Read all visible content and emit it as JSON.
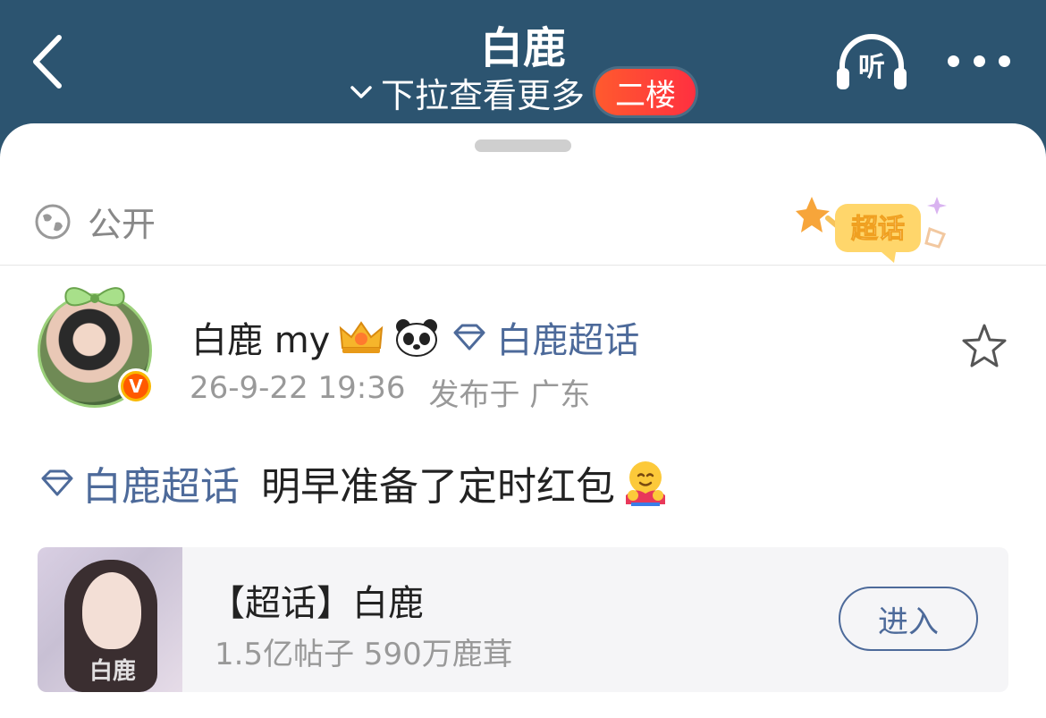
{
  "header": {
    "title": "白鹿",
    "subtitle": "下拉查看更多",
    "floor_badge": "二楼",
    "listen_label": "听"
  },
  "post": {
    "visibility": "公开",
    "chaohua_badge": "超话",
    "author": {
      "name": "白鹿 my",
      "topic": "白鹿超话",
      "verified_mark": "V"
    },
    "timestamp": "26-9-22 19:36",
    "location": "发布于 广东",
    "content_topic": "白鹿超话",
    "content_text": "明早准备了定时红包"
  },
  "topic_card": {
    "title": "【超话】白鹿",
    "stats": "1.5亿帖子 590万鹿茸",
    "enter_label": "进入",
    "image_text": "白鹿"
  },
  "colors": {
    "header_bg": "#2c5470",
    "link": "#4d6a9a",
    "floor_badge": "#ff4535"
  }
}
